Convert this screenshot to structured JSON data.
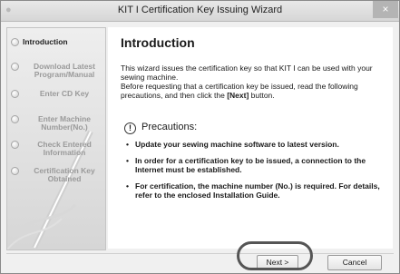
{
  "window": {
    "title": "KIT I Certification Key Issuing Wizard",
    "app_icon": "wizard-app-icon",
    "close_icon": "×"
  },
  "sidebar": {
    "items": [
      {
        "label": "Introduction",
        "active": true
      },
      {
        "label": "Download Latest Program/Manual",
        "active": false
      },
      {
        "label": "Enter CD Key",
        "active": false
      },
      {
        "label": "Enter Machine Number(No.)",
        "active": false
      },
      {
        "label": "Check Entered Information",
        "active": false
      },
      {
        "label": "Certification Key Obtained",
        "active": false
      }
    ]
  },
  "main": {
    "heading": "Introduction",
    "intro_line1": "This wizard issues the certification key so that KIT I can be used with your sewing machine.",
    "intro_line2a": "Before requesting that a certification key be issued, read the following precautions, and then click the ",
    "intro_line2b": "[Next]",
    "intro_line2c": " button.",
    "precautions_icon": "!",
    "precautions_title": "Precautions:",
    "precautions": [
      "Update your sewing machine software to latest version.",
      "In order for a certification key to be issued, a connection to the Internet must be established.",
      "For certification, the machine number (No.) is required. For details, refer to the enclosed Installation Guide."
    ]
  },
  "buttons": {
    "next": "Next >",
    "cancel": "Cancel"
  },
  "colors": {
    "highlight_ring": "#555555",
    "sidebar_text_inactive": "#9a9a9a"
  }
}
